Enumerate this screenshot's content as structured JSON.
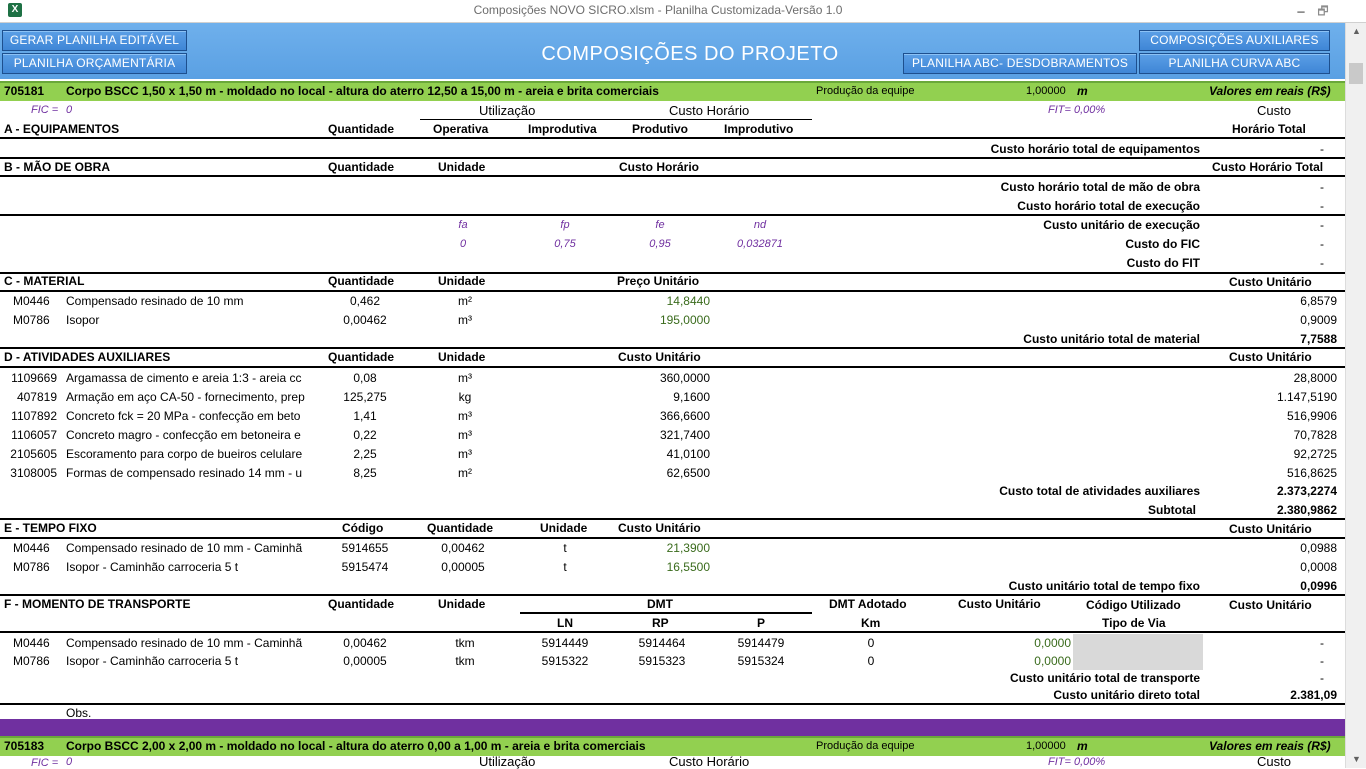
{
  "window": {
    "title": "Composições NOVO SICRO.xlsm  -  Planilha Customizada-Versão 1.0",
    "app_icon": "excel-icon",
    "buttons": {
      "minimize": "🗕",
      "restore": "🗗"
    }
  },
  "header": {
    "title": "COMPOSIÇÕES DO PROJETO",
    "btn_gerar": "GERAR PLANILHA EDITÁVEL",
    "btn_orcamentaria": "PLANILHA ORÇAMENTÁRIA",
    "btn_abc_desd": "PLANILHA ABC- DESDOBRAMENTOS",
    "btn_aux": "COMPOSIÇÕES AUXILIARES",
    "btn_curva": "PLANILHA CURVA ABC"
  },
  "comp1": {
    "code": "705181",
    "desc": "Corpo BSCC 1,50 x 1,50 m - moldado no local - altura do aterro 12,50 a 15,00 m - areia e brita comerciais",
    "prod_label": "Produção da equipe",
    "prod_value": "1,00000",
    "prod_unit": "m",
    "valores": "Valores em reais (R$)",
    "fic_label": "FIC =",
    "fic_value": "0",
    "fit_label": "FIT=  0,00%",
    "equip": {
      "title": "A - EQUIPAMENTOS",
      "quantidade": "Quantidade",
      "utilizacao": "Utilização",
      "custo_horario": "Custo Horário",
      "operativa": "Operativa",
      "improdutiva": "Improdutiva",
      "produtivo": "Produtivo",
      "improdutivo": "Improdutivo",
      "custo": "Custo",
      "horario_total": "Horário Total",
      "total_label": "Custo horário total de equipamentos",
      "total_value": "-"
    },
    "mao": {
      "title": "B - MÃO DE OBRA",
      "quantidade": "Quantidade",
      "unidade": "Unidade",
      "custo_horario": "Custo Horário",
      "custo_horario_total": "Custo Horário Total",
      "total_label": "Custo horário total de mão de obra",
      "total_value": "-",
      "exec_label": "Custo horário total de execução",
      "exec_value": "-"
    },
    "factors": {
      "fa": "fa",
      "fp": "fp",
      "fe": "fe",
      "nd": "nd",
      "fa_v": "0",
      "fp_v": "0,75",
      "fe_v": "0,95",
      "nd_v": "0,032871",
      "unit_exec_label": "Custo unitário de execução",
      "unit_exec_value": "-",
      "fic_cost_label": "Custo do FIC",
      "fic_cost_value": "-",
      "fit_cost_label": "Custo do FIT",
      "fit_cost_value": "-"
    },
    "material": {
      "title": "C - MATERIAL",
      "quantidade": "Quantidade",
      "unidade": "Unidade",
      "preco": "Preço Unitário",
      "custo": "Custo Unitário",
      "rows": [
        {
          "code": "M0446",
          "desc": "Compensado resinado de 10 mm",
          "qty": "0,462",
          "unit": "m²",
          "price": "14,8440",
          "cost": "6,8579"
        },
        {
          "code": "M0786",
          "desc": "Isopor",
          "qty": "0,00462",
          "unit": "m³",
          "price": "195,0000",
          "cost": "0,9009"
        }
      ],
      "total_label": "Custo unitário total de material",
      "total_value": "7,7588"
    },
    "aux": {
      "title": "D - ATIVIDADES AUXILIARES",
      "quantidade": "Quantidade",
      "unidade": "Unidade",
      "custo_unitario": "Custo Unitário",
      "custo": "Custo Unitário",
      "rows": [
        {
          "code": "1109669",
          "desc": "Argamassa de cimento e areia 1:3 - areia cc",
          "qty": "0,08",
          "unit": "m³",
          "price": "360,0000",
          "cost": "28,8000"
        },
        {
          "code": "407819",
          "desc": "Armação em aço CA-50 - fornecimento, prep",
          "qty": "125,275",
          "unit": "kg",
          "price": "9,1600",
          "cost": "1.147,5190"
        },
        {
          "code": "1107892",
          "desc": "Concreto fck = 20 MPa - confecção em beto",
          "qty": "1,41",
          "unit": "m³",
          "price": "366,6600",
          "cost": "516,9906"
        },
        {
          "code": "1106057",
          "desc": "Concreto magro - confecção em betoneira e",
          "qty": "0,22",
          "unit": "m³",
          "price": "321,7400",
          "cost": "70,7828"
        },
        {
          "code": "2105605",
          "desc": "Escoramento para corpo de bueiros celulare",
          "qty": "2,25",
          "unit": "m³",
          "price": "41,0100",
          "cost": "92,2725"
        },
        {
          "code": "3108005",
          "desc": "Formas de compensado resinado 14 mm - u",
          "qty": "8,25",
          "unit": "m²",
          "price": "62,6500",
          "cost": "516,8625"
        }
      ],
      "total_label": "Custo total de atividades auxiliares",
      "total_value": "2.373,2274",
      "subtotal_label": "Subtotal",
      "subtotal_value": "2.380,9862"
    },
    "tempo": {
      "title": "E - TEMPO FIXO",
      "codigo": "Código",
      "quantidade": "Quantidade",
      "unidade": "Unidade",
      "custo_unitario": "Custo Unitário",
      "custo": "Custo Unitário",
      "rows": [
        {
          "code": "M0446",
          "desc": "Compensado resinado de 10 mm - Caminhã",
          "cod": "5914655",
          "qty": "0,00462",
          "unit": "t",
          "price": "21,3900",
          "cost": "0,0988"
        },
        {
          "code": "M0786",
          "desc": "Isopor - Caminhão carroceria 5 t",
          "cod": "5915474",
          "qty": "0,00005",
          "unit": "t",
          "price": "16,5500",
          "cost": "0,0008"
        }
      ],
      "total_label": "Custo unitário total de tempo fixo",
      "total_value": "0,0996"
    },
    "transp": {
      "title": "F - MOMENTO DE TRANSPORTE",
      "quantidade": "Quantidade",
      "unidade": "Unidade",
      "dmt": "DMT",
      "ln": "LN",
      "rp": "RP",
      "p": "P",
      "dmt_adotado": "DMT Adotado",
      "km": "Km",
      "custo_unitario": "Custo Unitário",
      "codigo_utilizado": "Código Utilizado",
      "tipo_via": "Tipo de Via",
      "custo": "Custo Unitário",
      "rows": [
        {
          "code": "M0446",
          "desc": "Compensado resinado de 10 mm - Caminhã",
          "qty": "0,00462",
          "unit": "tkm",
          "ln": "5914449",
          "rp": "5914464",
          "p": "5914479",
          "dmt": "0",
          "price": "0,0000",
          "cost": "-"
        },
        {
          "code": "M0786",
          "desc": "Isopor - Caminhão carroceria 5 t",
          "qty": "0,00005",
          "unit": "tkm",
          "ln": "5915322",
          "rp": "5915323",
          "p": "5915324",
          "dmt": "0",
          "price": "0,0000",
          "cost": "-"
        }
      ],
      "total_label": "Custo unitário total de transporte",
      "total_value": "-",
      "direct_label": "Custo unitário direto total",
      "direct_value": "2.381,09"
    },
    "obs": "Obs."
  },
  "comp2": {
    "code": "705183",
    "desc": "Corpo BSCC 2,00 x 2,00 m - moldado no local - altura do aterro 0,00 a 1,00 m - areia e brita comerciais",
    "prod_label": "Produção da equipe",
    "prod_value": "1,00000",
    "prod_unit": "m",
    "valores": "Valores em reais (R$)",
    "fic_label": "FIC =",
    "fic_value": "0",
    "utilizacao": "Utilização",
    "custo_horario": "Custo Horário",
    "fit_label": "FIT=  0,00%",
    "custo": "Custo"
  }
}
